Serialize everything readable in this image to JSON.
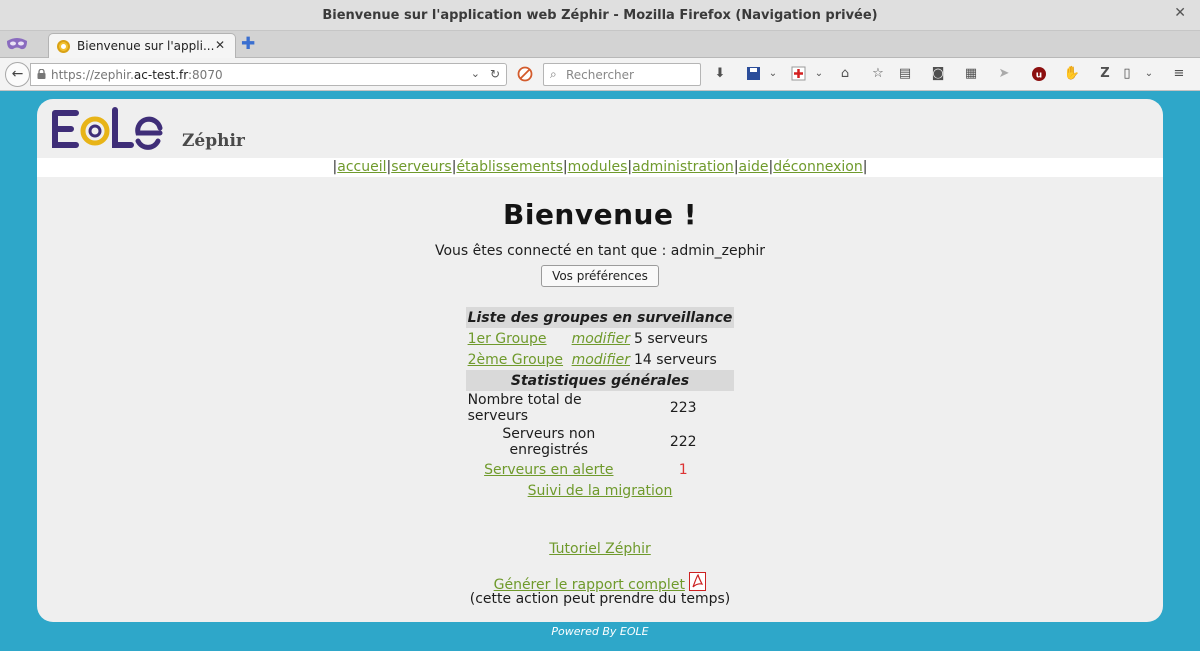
{
  "window": {
    "title": "Bienvenue sur l'application web Zéphir - Mozilla Firefox (Navigation privée)",
    "close": "✕"
  },
  "tab": {
    "label": "Bienvenue sur l'appli...",
    "close": "✕",
    "new_tab": "✚"
  },
  "navbar": {
    "url_prefix": "https://zephir.",
    "url_domain": "ac-test.fr",
    "url_suffix": ":8070",
    "search_placeholder": "Rechercher"
  },
  "site": {
    "brand": "Zéphir",
    "menu": [
      "accueil",
      "serveurs",
      "établissements",
      "modules",
      "administration",
      "aide",
      "déconnexion"
    ],
    "heading": "Bienvenue !",
    "connected_label": "Vous êtes connecté en tant que : admin_zephir",
    "preferences_button": "Vos préférences",
    "groups_header": "Liste des groupes en surveillance",
    "groups": [
      {
        "name": "1er Groupe",
        "action": "modifier",
        "count": "5 serveurs"
      },
      {
        "name": "2ème Groupe",
        "action": "modifier",
        "count": "14 serveurs"
      }
    ],
    "stats_header": "Statistiques générales",
    "stats": {
      "total_label": "Nombre total de serveurs",
      "total_value": "223",
      "unregistered_label": "Serveurs non enregistrés",
      "unregistered_value": "222",
      "alert_label": "Serveurs en alerte",
      "alert_value": "1",
      "migration_label": "Suivi de la migration"
    },
    "tutorial_link": "Tutoriel Zéphir",
    "report_link": "Générer le rapport complet",
    "report_note": "(cette action peut prendre du temps)",
    "footer": "Powered By EOLE"
  },
  "colors": {
    "link": "#6f9a2c",
    "background": "#2ea7c9",
    "panel": "#efefef",
    "alert": "#dd3333"
  }
}
